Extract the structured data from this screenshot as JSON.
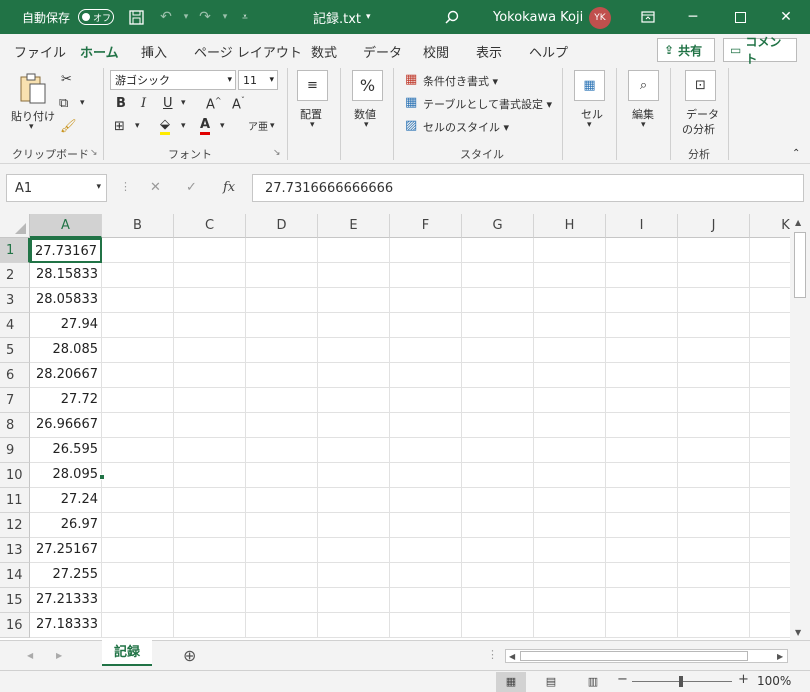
{
  "titlebar": {
    "autosave_label": "自動保存",
    "autosave_state": "オフ",
    "title": "記録.txt",
    "user_name": "Yokokawa Koji",
    "avatar_initials": "YK"
  },
  "tabs": [
    "ファイル",
    "ホーム",
    "挿入",
    "ページ レイアウト",
    "数式",
    "データ",
    "校閲",
    "表示",
    "ヘルプ"
  ],
  "active_tab": "ホーム",
  "actions": {
    "share": "共有",
    "comment": "コメント"
  },
  "ribbon": {
    "clipboard": {
      "label": "クリップボード",
      "paste": "貼り付け"
    },
    "font": {
      "label": "フォント",
      "font_name": "游ゴシック",
      "font_size": "11"
    },
    "alignment": {
      "label": "配置"
    },
    "number": {
      "label": "数値"
    },
    "styles": {
      "label": "スタイル",
      "conditional": "条件付き書式",
      "table_format": "テーブルとして書式設定",
      "cell_styles": "セルのスタイル"
    },
    "cells": {
      "label": "セル"
    },
    "editing": {
      "label": "編集"
    },
    "analysis": {
      "label": "分析",
      "data_analysis_line1": "データ",
      "data_analysis_line2": "の分析"
    }
  },
  "formula_bar": {
    "name_box": "A1",
    "formula": "27.7316666666666"
  },
  "columns": [
    "A",
    "B",
    "C",
    "D",
    "E",
    "F",
    "G",
    "H",
    "I",
    "J",
    "K"
  ],
  "rows": [
    {
      "num": "1",
      "a": "27.73167"
    },
    {
      "num": "2",
      "a": "28.15833"
    },
    {
      "num": "3",
      "a": "28.05833"
    },
    {
      "num": "4",
      "a": "27.94"
    },
    {
      "num": "5",
      "a": "28.085"
    },
    {
      "num": "6",
      "a": "28.20667"
    },
    {
      "num": "7",
      "a": "27.72"
    },
    {
      "num": "8",
      "a": "26.96667"
    },
    {
      "num": "9",
      "a": "26.595"
    },
    {
      "num": "10",
      "a": "28.095"
    },
    {
      "num": "11",
      "a": "27.24"
    },
    {
      "num": "12",
      "a": "26.97"
    },
    {
      "num": "13",
      "a": "27.25167"
    },
    {
      "num": "14",
      "a": "27.255"
    },
    {
      "num": "15",
      "a": "27.21333"
    },
    {
      "num": "16",
      "a": "27.18333"
    }
  ],
  "sheet": {
    "name": "記録"
  },
  "status": {
    "zoom": "100%"
  }
}
